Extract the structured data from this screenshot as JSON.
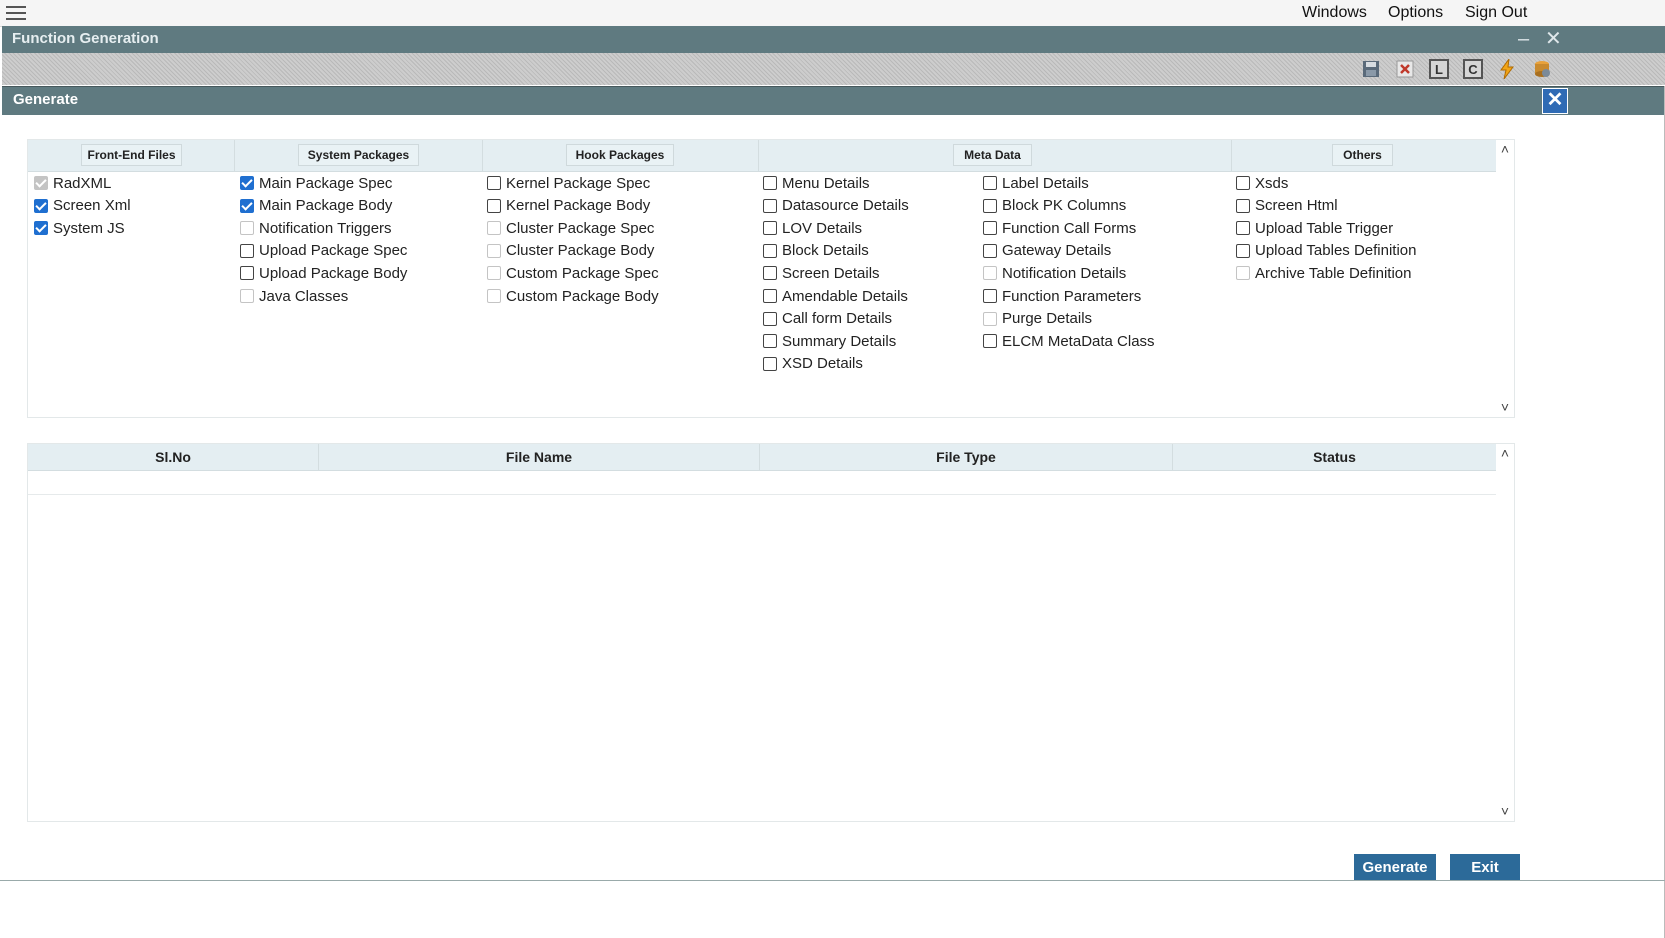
{
  "menubar": {
    "windows": "Windows",
    "options": "Options",
    "signout": "Sign Out"
  },
  "window": {
    "title": "Function Generation",
    "minimize": "–",
    "close": "✕"
  },
  "toolbar": {
    "l": "L",
    "c": "C"
  },
  "dialog": {
    "title": "Generate",
    "close": "✕"
  },
  "columns": {
    "frontend": "Front-End Files",
    "system": "System Packages",
    "hook": "Hook Packages",
    "meta": "Meta Data",
    "others": "Others"
  },
  "options": {
    "frontend": [
      {
        "label": "RadXML",
        "state": "disabled-checked"
      },
      {
        "label": "Screen Xml",
        "state": "checked"
      },
      {
        "label": "System JS",
        "state": "checked"
      }
    ],
    "system": [
      {
        "label": "Main Package Spec",
        "state": "checked"
      },
      {
        "label": "Main Package Body",
        "state": "checked"
      },
      {
        "label": "Notification Triggers",
        "state": "disabled"
      },
      {
        "label": "Upload Package Spec",
        "state": "unchecked"
      },
      {
        "label": "Upload Package Body",
        "state": "unchecked"
      },
      {
        "label": "Java Classes",
        "state": "disabled"
      }
    ],
    "hook": [
      {
        "label": "Kernel Package Spec",
        "state": "unchecked"
      },
      {
        "label": "Kernel Package Body",
        "state": "unchecked"
      },
      {
        "label": "Cluster Package Spec",
        "state": "disabled"
      },
      {
        "label": "Cluster Package Body",
        "state": "disabled"
      },
      {
        "label": "Custom Package Spec",
        "state": "disabled"
      },
      {
        "label": "Custom Package Body",
        "state": "disabled"
      }
    ],
    "meta1": [
      {
        "label": "Menu Details",
        "state": "unchecked"
      },
      {
        "label": "Datasource Details",
        "state": "unchecked"
      },
      {
        "label": "LOV Details",
        "state": "unchecked"
      },
      {
        "label": "Block Details",
        "state": "unchecked"
      },
      {
        "label": "Screen Details",
        "state": "unchecked"
      },
      {
        "label": "Amendable Details",
        "state": "unchecked"
      },
      {
        "label": "Call form Details",
        "state": "unchecked"
      },
      {
        "label": "Summary Details",
        "state": "unchecked"
      },
      {
        "label": "XSD Details",
        "state": "unchecked"
      }
    ],
    "meta2": [
      {
        "label": "Label Details",
        "state": "unchecked"
      },
      {
        "label": "Block PK Columns",
        "state": "unchecked"
      },
      {
        "label": "Function Call Forms",
        "state": "unchecked"
      },
      {
        "label": "Gateway Details",
        "state": "unchecked"
      },
      {
        "label": "Notification Details",
        "state": "disabled"
      },
      {
        "label": "Function Parameters",
        "state": "unchecked"
      },
      {
        "label": "Purge Details",
        "state": "disabled"
      },
      {
        "label": "ELCM MetaData Class",
        "state": "unchecked"
      }
    ],
    "others": [
      {
        "label": "Xsds",
        "state": "unchecked"
      },
      {
        "label": "Screen Html",
        "state": "unchecked"
      },
      {
        "label": "Upload Table Trigger",
        "state": "unchecked"
      },
      {
        "label": "Upload Tables Definition",
        "state": "unchecked"
      },
      {
        "label": "Archive Table Definition",
        "state": "disabled"
      }
    ]
  },
  "grid": {
    "slno": "Sl.No",
    "filename": "File Name",
    "filetype": "File Type",
    "status": "Status"
  },
  "buttons": {
    "generate": "Generate",
    "exit": "Exit"
  },
  "scroll": {
    "up": "˄",
    "down": "˅"
  }
}
